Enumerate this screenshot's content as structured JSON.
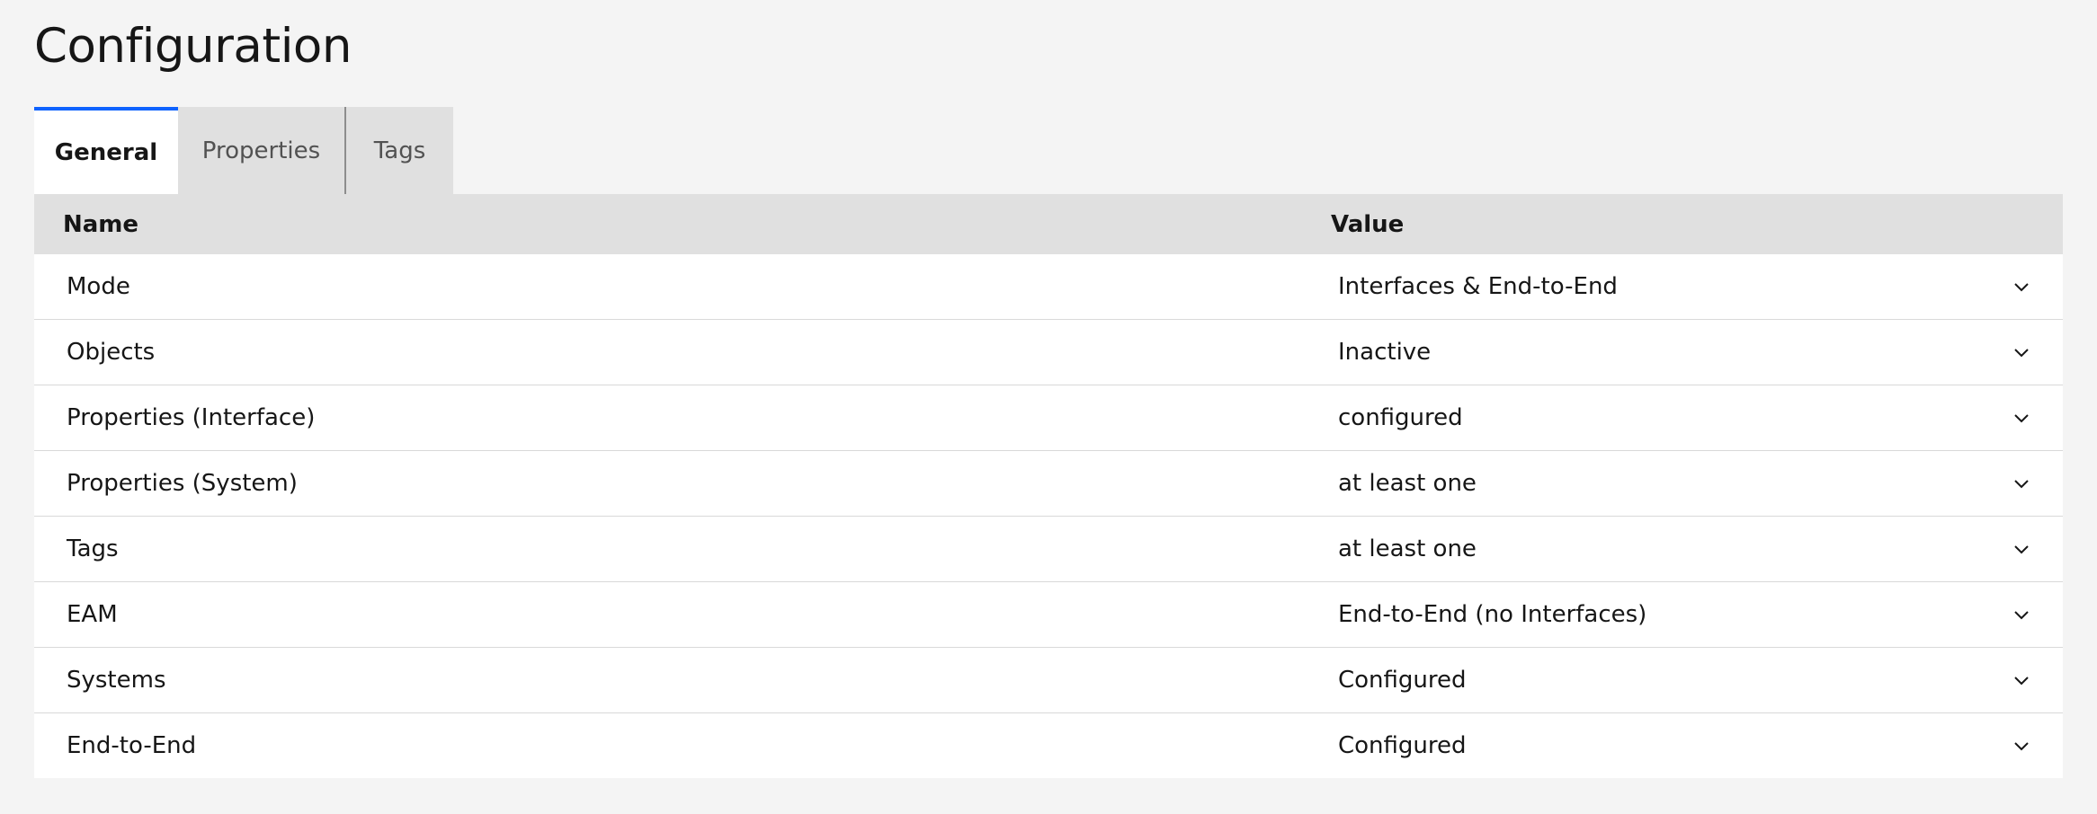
{
  "page": {
    "title": "Configuration"
  },
  "tabs": [
    {
      "label": "General",
      "active": true
    },
    {
      "label": "Properties",
      "active": false
    },
    {
      "label": "Tags",
      "active": false
    }
  ],
  "table": {
    "headers": {
      "name": "Name",
      "value": "Value"
    },
    "rows": [
      {
        "name": "Mode",
        "value": "Interfaces & End-to-End"
      },
      {
        "name": "Objects",
        "value": "Inactive"
      },
      {
        "name": "Properties (Interface)",
        "value": "configured"
      },
      {
        "name": "Properties (System)",
        "value": "at least one"
      },
      {
        "name": "Tags",
        "value": "at least one"
      },
      {
        "name": "EAM",
        "value": "End-to-End (no Interfaces)"
      },
      {
        "name": "Systems",
        "value": "Configured"
      },
      {
        "name": "End-to-End",
        "value": "Configured"
      }
    ]
  },
  "icons": {
    "row_expand": "chevron-down-icon"
  },
  "colors": {
    "accent": "#0f62fe",
    "background": "#f4f4f4",
    "header": "#e0e0e0"
  }
}
